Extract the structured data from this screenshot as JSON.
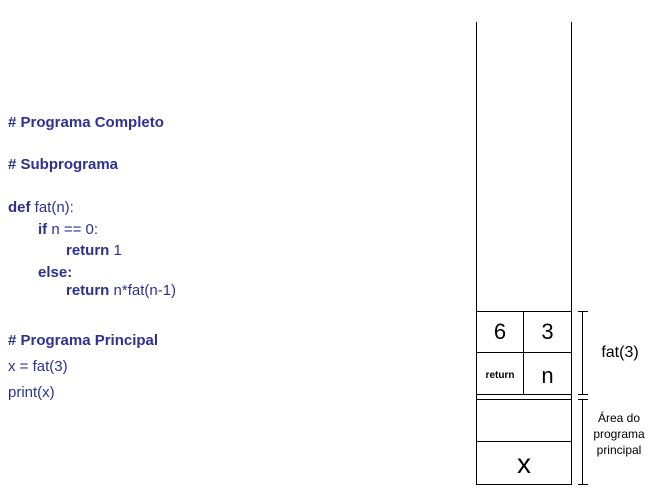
{
  "code": {
    "title_complete": "# Programa Completo",
    "title_sub": "# Subprograma",
    "def_kw": "def",
    "def_rest": "fat(n):",
    "if_kw": "if",
    "if_rest": "n == 0:",
    "return1_kw": "return",
    "return1_rest": "1",
    "else_kw": "else:",
    "return2_kw": "return",
    "return2_rest": "n*fat(n-1)",
    "title_main": "# Programa Principal",
    "main_line1": "x = fat(3)",
    "main_line2": "print(x)"
  },
  "stack": {
    "fat_return_value": "6",
    "fat_n_value": "3",
    "fat_return_label": "return",
    "fat_n_label": "n",
    "main_var": "x",
    "fat_frame_label": "fat(3)",
    "main_frame_label_1": "Área do",
    "main_frame_label_2": "programa",
    "main_frame_label_3": "principal"
  }
}
